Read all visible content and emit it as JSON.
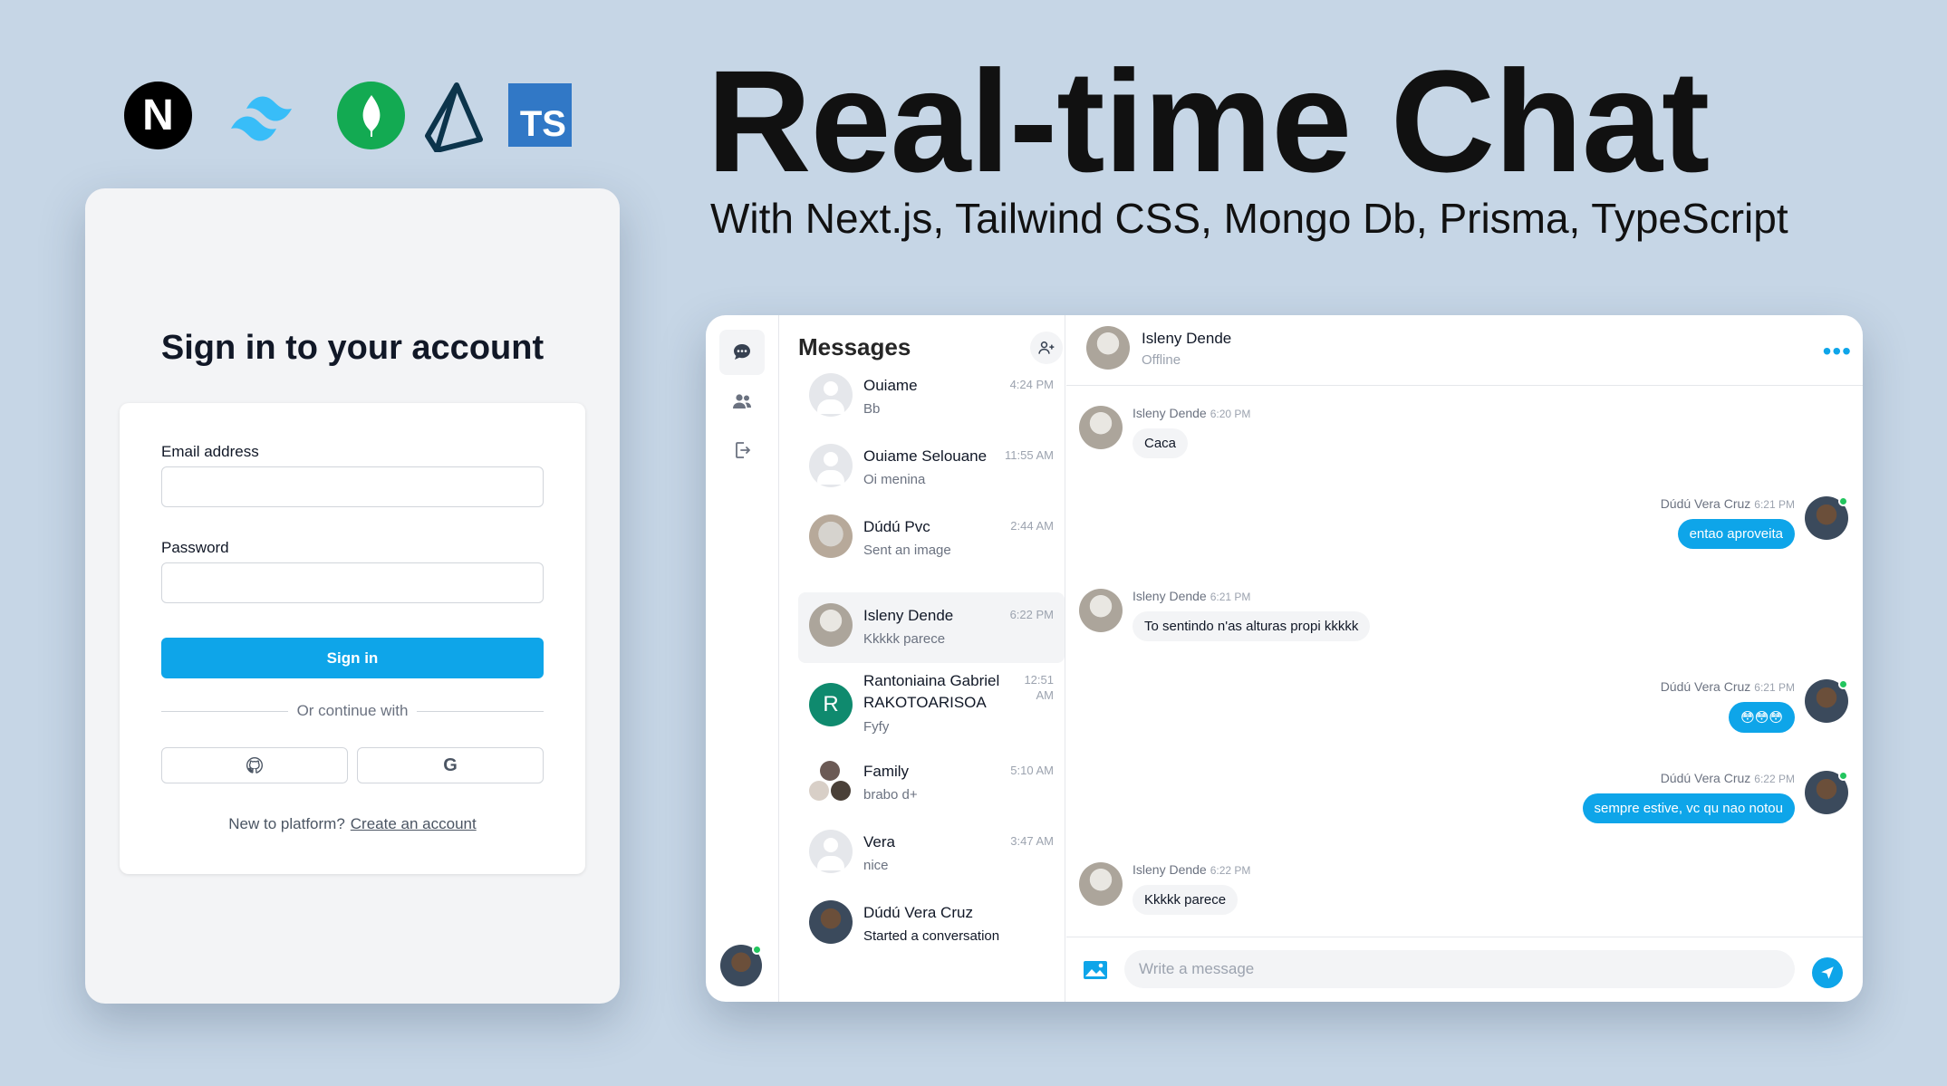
{
  "hero": {
    "title": "Real-time Chat",
    "subtitle": "With Next.js, Tailwind CSS, Mongo Db, Prisma, TypeScript"
  },
  "logos": {
    "next_letter": "N",
    "ts_letters": "TS"
  },
  "signin": {
    "title": "Sign in to your account",
    "email_label": "Email address",
    "email_value": "",
    "password_label": "Password",
    "password_value": "",
    "submit_label": "Sign in",
    "divider_text": "Or continue with",
    "new_text": "New to platform?",
    "create_link": "Create an account",
    "google_letter": "G"
  },
  "chat": {
    "list_title": "Messages",
    "conversations": [
      {
        "name": "Ouiame",
        "time": "4:24 PM",
        "last": "Bb"
      },
      {
        "name": "Ouiame Selouane",
        "time": "11:55 AM",
        "last": "Oi menina"
      },
      {
        "name": "Dúdú Pvc",
        "time": "2:44 AM",
        "last": "Sent an image"
      },
      {
        "name": "Isleny Dende",
        "time": "6:22 PM",
        "last": "Kkkkk parece"
      },
      {
        "name": "Rantoniaina Gabriel RAKOTOARISOA",
        "time": "12:51 AM",
        "last": "Fyfy",
        "initial": "R"
      },
      {
        "name": "Family",
        "time": "5:10 AM",
        "last": "brabo d+"
      },
      {
        "name": "Vera",
        "time": "3:47 AM",
        "last": "nice"
      },
      {
        "name": "Dúdú Vera Cruz",
        "time": "",
        "last": "Started a conversation"
      }
    ],
    "header": {
      "name": "Isleny Dende",
      "status": "Offline",
      "menu": "•••"
    },
    "messages": [
      {
        "sender": "Isleny Dende",
        "time": "6:20 PM",
        "text": "Caca",
        "dir": "in"
      },
      {
        "sender": "Dúdú Vera Cruz",
        "time": "6:21 PM",
        "text": "entao aproveita",
        "dir": "out"
      },
      {
        "sender": "Isleny Dende",
        "time": "6:21 PM",
        "text": "To sentindo n'as alturas propi kkkkk",
        "dir": "in"
      },
      {
        "sender": "Dúdú Vera Cruz",
        "time": "6:21 PM",
        "text": "😳😳😳",
        "dir": "out"
      },
      {
        "sender": "Dúdú Vera Cruz",
        "time": "6:22 PM",
        "text": "sempre estive, vc qu nao notou",
        "dir": "out"
      },
      {
        "sender": "Isleny Dende",
        "time": "6:22 PM",
        "text": "Kkkkk parece",
        "dir": "in"
      }
    ],
    "composer": {
      "placeholder": "Write a message"
    }
  },
  "colors": {
    "background": "#c6d6e6",
    "accent": "#0ea5e9",
    "online": "#22c55e"
  },
  "icons": [
    "nextjs-logo",
    "tailwind-logo",
    "mongodb-logo",
    "prisma-logo",
    "typescript-logo",
    "chat-icon",
    "users-icon",
    "logout-icon",
    "add-user-icon",
    "github-icon",
    "google-icon",
    "image-icon",
    "send-icon"
  ]
}
